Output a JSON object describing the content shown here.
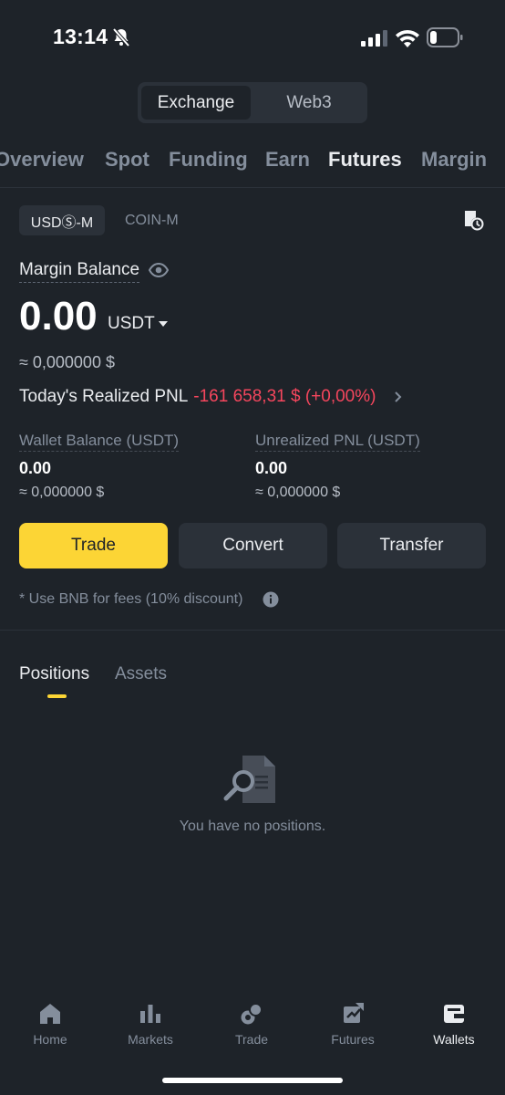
{
  "status_bar": {
    "time": "13:14"
  },
  "mode_switch": {
    "active": "Exchange",
    "inactive": "Web3"
  },
  "wallet_tabs": [
    "Overview",
    "Spot",
    "Funding",
    "Earn",
    "Futures",
    "Margin"
  ],
  "futures": {
    "sub_tabs": {
      "active": "USDⓈ-M",
      "inactive": "COIN-M"
    },
    "margin_balance_label": "Margin Balance",
    "margin_balance_value": "0.00",
    "currency": "USDT",
    "approx_value": "≈ 0,000000 $",
    "realized_pnl_label": "Today's Realized PNL",
    "realized_pnl_value": "-161 658,31 $ (+0,00%)",
    "wallet_balance": {
      "label": "Wallet Balance (USDT)",
      "value": "0.00",
      "approx": "≈ 0,000000 $"
    },
    "unrealized_pnl": {
      "label": "Unrealized PNL (USDT)",
      "value": "0.00",
      "approx": "≈ 0,000000 $"
    },
    "buttons": {
      "trade": "Trade",
      "convert": "Convert",
      "transfer": "Transfer"
    },
    "bnb_note": "*  Use BNB for fees (10% discount)"
  },
  "positions": {
    "tabs": {
      "active": "Positions",
      "inactive": "Assets"
    },
    "empty_text": "You have no positions."
  },
  "bottom_nav": [
    {
      "label": "Home",
      "icon": "home-icon"
    },
    {
      "label": "Markets",
      "icon": "markets-icon"
    },
    {
      "label": "Trade",
      "icon": "trade-icon"
    },
    {
      "label": "Futures",
      "icon": "futures-icon"
    },
    {
      "label": "Wallets",
      "icon": "wallet-icon",
      "active": true
    }
  ],
  "colors": {
    "background": "#1e2329",
    "accent": "#fcd535",
    "negative": "#f6465d"
  }
}
